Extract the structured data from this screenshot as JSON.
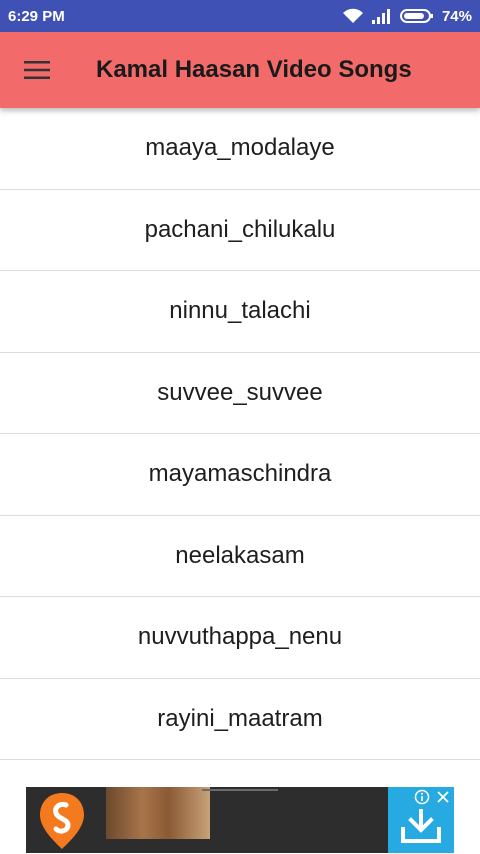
{
  "status_bar": {
    "time": "6:29 PM",
    "battery": "74%"
  },
  "app_bar": {
    "title": "Kamal Haasan Video Songs"
  },
  "songs": [
    "maaya_modalaye",
    "pachani_chilukalu",
    "ninnu_talachi",
    "suvvee_suvvee",
    "mayamaschindra",
    "neelakasam",
    "nuvvuthappa_nenu",
    "rayini_maatram"
  ],
  "colors": {
    "status_bar": "#3f51b5",
    "app_bar": "#f26a6a",
    "ad_logo": "#f47a20",
    "ad_cta": "#27a9e1"
  }
}
